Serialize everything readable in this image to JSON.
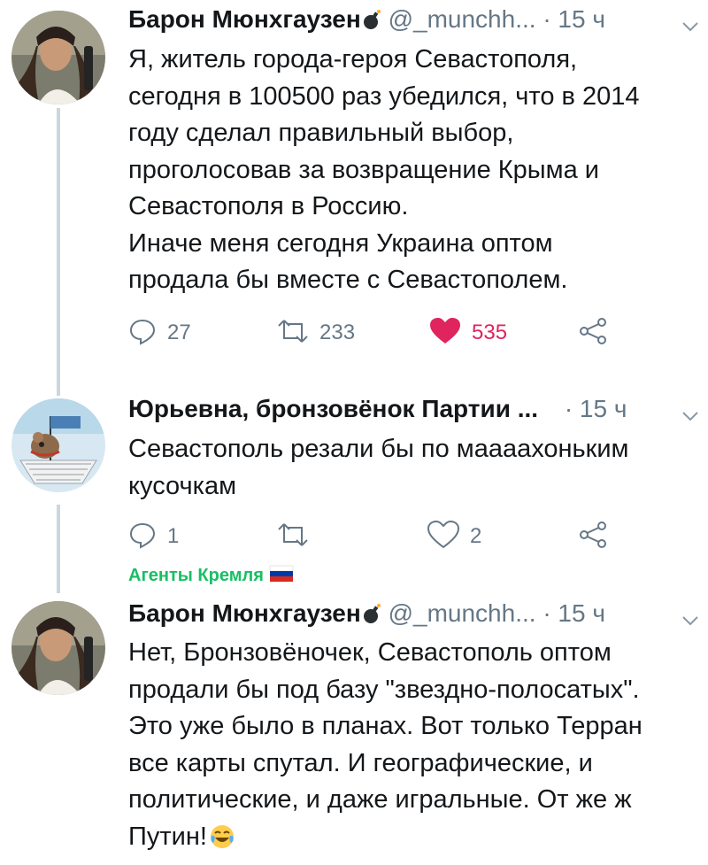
{
  "tweets": [
    {
      "author_name": "Барон Мюнхгаузен",
      "handle": "@_munchh...",
      "time": "· 15 ч",
      "lines": [
        "Я, житель города-героя Севастополя,",
        "сегодня в 100500 раз убедился, что в 2014",
        "году сделал правильный выбор,",
        "проголосовав за возвращение Крыма и",
        "Севастополя в Россию.",
        "Иначе меня сегодня Украина оптом",
        "продала бы вместе с Севастополем."
      ],
      "replies": "27",
      "retweets": "233",
      "likes": "535",
      "icons": {
        "badge": "bomb-icon",
        "menu": "chevron-down-icon",
        "reply": "reply-icon",
        "retweet": "retweet-icon",
        "like": "heart-filled-icon",
        "share": "share-icon"
      },
      "colors": {
        "like": "#e0245e"
      }
    },
    {
      "author_name": "Юрьевна, бронзовёнок Партии ...",
      "time": "· 15 ч",
      "lines": [
        "Севастополь резали бы по маааахоньким",
        "кусочкам"
      ],
      "replies": "1",
      "retweets": "",
      "likes": "2",
      "tag": "Агенты Кремля",
      "icons": {
        "menu": "chevron-down-icon",
        "reply": "reply-icon",
        "retweet": "retweet-icon",
        "like": "heart-outline-icon",
        "share": "share-icon",
        "flag": "russia-flag-icon"
      },
      "colors": {
        "tag": "#17bf63"
      }
    },
    {
      "author_name": "Барон Мюнхгаузен",
      "handle": "@_munchh...",
      "time": "· 15 ч",
      "lines": [
        "Нет, Бронзовёночек, Севастополь оптом",
        "продали бы под базу \"звездно-полосатых\".",
        "Это уже было в планах. Вот только Терран",
        "все карты спутал. И географические, и",
        "политические, и даже игральные. От же ж",
        "Путин!"
      ],
      "icons": {
        "badge": "bomb-icon",
        "menu": "chevron-down-icon",
        "emoji": "tears-of-joy-emoji"
      }
    }
  ],
  "colors": {
    "text": "#14171a",
    "muted": "#657786",
    "thread_line": "#ccd6dd"
  }
}
